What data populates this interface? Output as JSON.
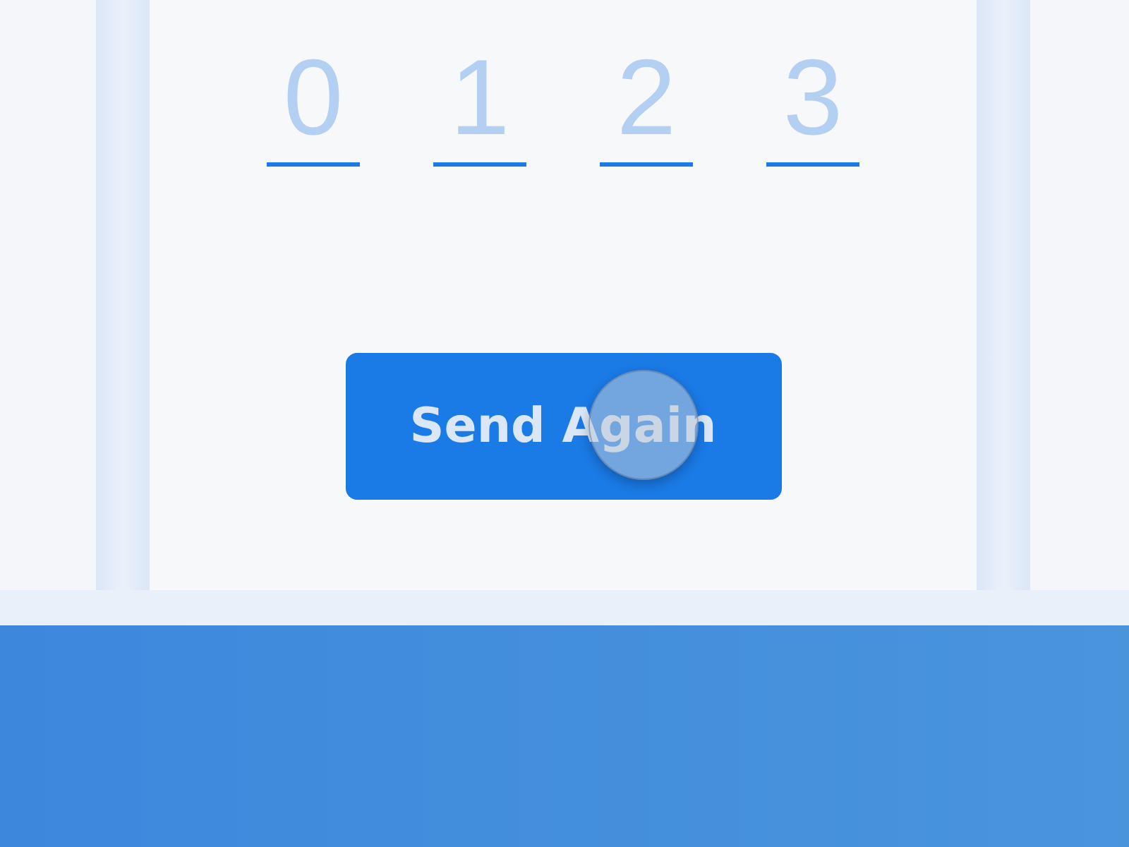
{
  "code_fields": [
    {
      "placeholder": "0"
    },
    {
      "placeholder": "1"
    },
    {
      "placeholder": "2"
    },
    {
      "placeholder": "3"
    }
  ],
  "button": {
    "label": "Send Again"
  }
}
